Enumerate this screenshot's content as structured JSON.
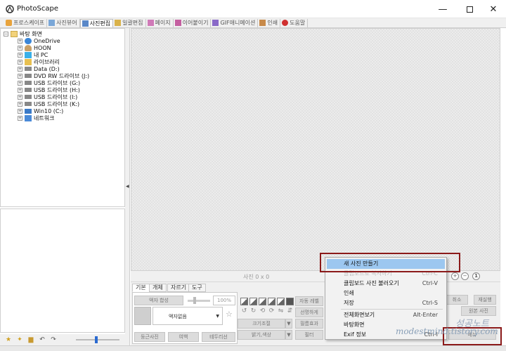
{
  "app": {
    "title": "PhotoScape",
    "window_controls": [
      "minimize-icon",
      "maximize-icon",
      "close-icon"
    ]
  },
  "tabs": [
    {
      "label": "프로스케이프",
      "icon": "home-icon",
      "active": false
    },
    {
      "label": "사진뷰어",
      "icon": "viewer-icon",
      "active": false
    },
    {
      "label": "사진편집",
      "icon": "editor-icon",
      "active": true
    },
    {
      "label": "일괄편집",
      "icon": "batch-icon",
      "active": false
    },
    {
      "label": "페이지",
      "icon": "page-icon",
      "active": false
    },
    {
      "label": "이어붙이기",
      "icon": "combine-icon",
      "active": false
    },
    {
      "label": "GIF애니메이션",
      "icon": "gif-icon",
      "active": false
    },
    {
      "label": "인쇄",
      "icon": "print-icon",
      "active": false
    },
    {
      "label": "도움말",
      "icon": "help-icon",
      "active": false
    }
  ],
  "folder_tree": [
    {
      "label": "바탕 화면",
      "icon": "desktop-folder-icon",
      "level": 0
    },
    {
      "label": "OneDrive",
      "icon": "cloud-icon",
      "level": 1
    },
    {
      "label": "HOON",
      "icon": "user-icon",
      "level": 1
    },
    {
      "label": "내 PC",
      "icon": "pc-icon",
      "level": 1
    },
    {
      "label": "라이브러리",
      "icon": "library-icon",
      "level": 1
    },
    {
      "label": "Data (D:)",
      "icon": "drive-icon",
      "level": 1
    },
    {
      "label": "DVD RW 드라이브 (J:)",
      "icon": "drive-icon",
      "level": 1
    },
    {
      "label": "USB 드라이브 (G:)",
      "icon": "drive-icon",
      "level": 1
    },
    {
      "label": "USB 드라이브 (H:)",
      "icon": "drive-icon",
      "level": 1
    },
    {
      "label": "USB 드라이브 (I:)",
      "icon": "drive-icon",
      "level": 1
    },
    {
      "label": "USB 드라이브 (K:)",
      "icon": "drive-icon",
      "level": 1
    },
    {
      "label": "Win10 (C:)",
      "icon": "drive-icon",
      "level": 1
    },
    {
      "label": "네트워크",
      "icon": "network-icon",
      "level": 1
    }
  ],
  "status": {
    "image_size": "사진 0 x 0"
  },
  "tool_tabs": [
    "기본",
    "개체",
    "자르기",
    "도구"
  ],
  "tool_panel": {
    "frame_button": "액자 합성",
    "zoom_value": "100%",
    "frame_name": "액자없음",
    "buttons": [
      "둥근사진",
      "여백",
      "테두리선"
    ],
    "size_buttons": [
      "크기조절",
      "밝기,색상"
    ],
    "mid_buttons": [
      "자동 레벨",
      "선명하게",
      "필름효과",
      "필터"
    ],
    "right_buttons": [
      "취소",
      "재실행",
      "원본 사진"
    ]
  },
  "context_menu": {
    "items": [
      {
        "label": "새 사진 만들기",
        "shortcut": "",
        "state": "highlighted"
      },
      {
        "label": "클립보드로 복사하기",
        "shortcut": "Ctrl-C",
        "state": "disabled"
      },
      {
        "label": "클립보드 사진 불러오기",
        "shortcut": "Ctrl-V",
        "state": "normal"
      },
      {
        "label": "인쇄",
        "shortcut": "",
        "state": "normal"
      },
      {
        "label": "저장",
        "shortcut": "Ctrl-S",
        "state": "normal"
      },
      {
        "label": "전체화면보기",
        "shortcut": "Alt-Enter",
        "state": "normal"
      },
      {
        "label": "바탕화면",
        "shortcut": "",
        "state": "normal"
      },
      {
        "label": "Exif 정보",
        "shortcut": "Ctrl-I",
        "state": "normal"
      }
    ]
  },
  "menu_button": "메뉴",
  "watermark": {
    "line1": "modestmind.tistory.com",
    "line2": "성공노트"
  },
  "colors": {
    "highlight": "#9cc7f0",
    "annotation_border": "#8b1a1a",
    "zoom_thumb": "#2a6ad0"
  }
}
